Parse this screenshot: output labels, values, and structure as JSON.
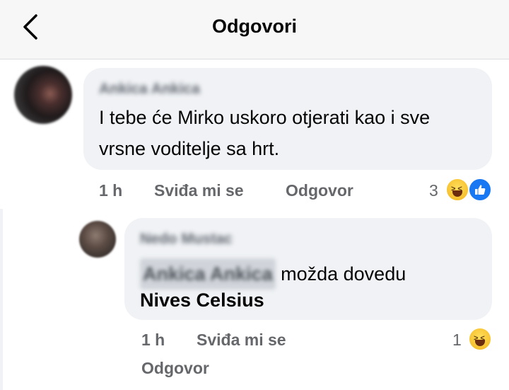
{
  "header": {
    "title": "Odgovori",
    "back_icon": "chevron-left-icon"
  },
  "comment": {
    "author": "Ankica Ankica",
    "text": "I tebe će Mirko uskoro otjerati kao i sve vrsne voditelje sa hrt.",
    "time": "1 h",
    "like_label": "Sviđa mi se",
    "reply_label": "Odgovor",
    "reaction_count": "3",
    "reactions": [
      "haha-icon",
      "like-icon"
    ]
  },
  "reply": {
    "author": "Nedo Mustac",
    "mention": "Ankica Ankica",
    "text": "možda dovedu",
    "tag": "Nives Celsius",
    "time": "1 h",
    "like_label": "Sviđa mi se",
    "reply_label": "Odgovor",
    "reaction_count": "1",
    "reactions": [
      "haha-icon"
    ]
  },
  "colors": {
    "bubble": "#f0f2f5",
    "meta": "#65676b",
    "like_blue": "#1877f2",
    "header_bg": "#f7f7f7"
  }
}
